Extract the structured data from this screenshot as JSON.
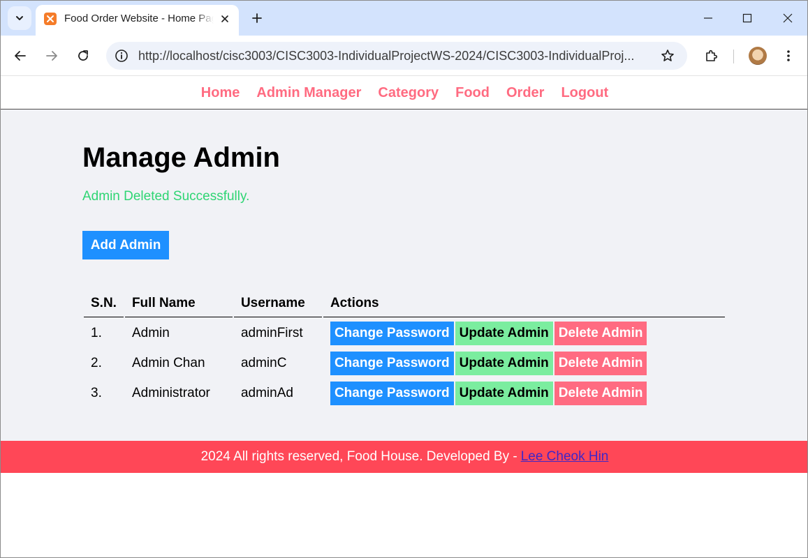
{
  "browser": {
    "tab_title": "Food Order Website - Home Page",
    "url": "http://localhost/cisc3003/CISC3003-IndividualProjectWS-2024/CISC3003-IndividualProj..."
  },
  "nav": {
    "items": [
      "Home",
      "Admin Manager",
      "Category",
      "Food",
      "Order",
      "Logout"
    ]
  },
  "main": {
    "title": "Manage Admin",
    "message": "Admin Deleted Successfully.",
    "add_button": "Add Admin",
    "table": {
      "headers": [
        "S.N.",
        "Full Name",
        "Username",
        "Actions"
      ],
      "rows": [
        {
          "sn": "1.",
          "full_name": "Admin",
          "username": "adminFirst"
        },
        {
          "sn": "2.",
          "full_name": "Admin Chan",
          "username": "adminC"
        },
        {
          "sn": "3.",
          "full_name": "Administrator",
          "username": "adminAd"
        }
      ],
      "action_labels": {
        "change_password": "Change Password",
        "update": "Update Admin",
        "delete": "Delete Admin"
      }
    }
  },
  "footer": {
    "text": "2024 All rights reserved, Food House. Developed By -",
    "author": "Lee Cheok Hin"
  },
  "colors": {
    "nav_link": "#ff6b81",
    "success": "#2ed573",
    "primary": "#1e90ff",
    "update": "#7bed9f",
    "danger": "#ff6b81",
    "footer_bg": "#ff4757"
  }
}
